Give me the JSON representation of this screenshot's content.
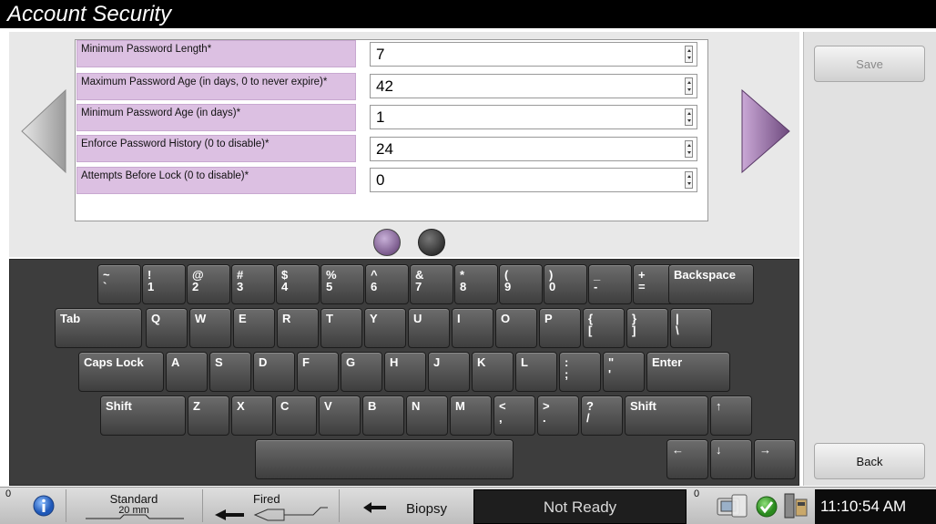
{
  "header": {
    "title": "Account Security"
  },
  "settings": [
    {
      "label": "Minimum Password Length*",
      "value": "7"
    },
    {
      "label": "Maximum Password Age (in days, 0 to never expire)*",
      "value": "42"
    },
    {
      "label": "Minimum Password Age (in days)*",
      "value": "1"
    },
    {
      "label": "Enforce Password History (0 to disable)*",
      "value": "24"
    },
    {
      "label": "Attempts Before Lock (0 to disable)*",
      "value": "0"
    }
  ],
  "pagination": {
    "pages": 2,
    "current": 1
  },
  "side": {
    "save_label": "Save",
    "back_label": "Back"
  },
  "keyboard": {
    "row1": [
      [
        "~",
        "`"
      ],
      [
        "!",
        "1"
      ],
      [
        "@",
        "2"
      ],
      [
        "#",
        "3"
      ],
      [
        "$",
        "4"
      ],
      [
        "%",
        "5"
      ],
      [
        "^",
        "6"
      ],
      [
        "&",
        "7"
      ],
      [
        "*",
        "8"
      ],
      [
        "(",
        "9"
      ],
      [
        ")",
        "0"
      ],
      [
        "_",
        "-"
      ],
      [
        "+",
        "="
      ],
      [
        "Backspace",
        ""
      ]
    ],
    "row2": [
      [
        "Tab",
        ""
      ],
      [
        "Q",
        ""
      ],
      [
        "W",
        ""
      ],
      [
        "E",
        ""
      ],
      [
        "R",
        ""
      ],
      [
        "T",
        ""
      ],
      [
        "Y",
        ""
      ],
      [
        "U",
        ""
      ],
      [
        "I",
        ""
      ],
      [
        "O",
        ""
      ],
      [
        "P",
        ""
      ],
      [
        "{",
        "["
      ],
      [
        "}",
        "]"
      ],
      [
        "|",
        "\\"
      ]
    ],
    "row3": [
      [
        "Caps Lock",
        ""
      ],
      [
        "A",
        ""
      ],
      [
        "S",
        ""
      ],
      [
        "D",
        ""
      ],
      [
        "F",
        ""
      ],
      [
        "G",
        ""
      ],
      [
        "H",
        ""
      ],
      [
        "J",
        ""
      ],
      [
        "K",
        ""
      ],
      [
        "L",
        ""
      ],
      [
        ":",
        ";"
      ],
      [
        "\"",
        "'"
      ],
      [
        "Enter",
        ""
      ]
    ],
    "row4": [
      [
        "Shift",
        ""
      ],
      [
        "Z",
        ""
      ],
      [
        "X",
        ""
      ],
      [
        "C",
        ""
      ],
      [
        "V",
        ""
      ],
      [
        "B",
        ""
      ],
      [
        "N",
        ""
      ],
      [
        "M",
        ""
      ],
      [
        "<",
        ","
      ],
      [
        ">",
        "."
      ],
      [
        "?",
        "/"
      ],
      [
        "Shift",
        ""
      ],
      [
        "↑",
        ""
      ]
    ],
    "row5": [
      [
        "",
        ""
      ],
      [
        "←",
        ""
      ],
      [
        "↓",
        ""
      ],
      [
        "→",
        ""
      ]
    ]
  },
  "status": {
    "left_count": "0",
    "paddle_name": "Standard",
    "paddle_size": "20 mm",
    "fired_label": "Fired",
    "biopsy_label": "Biopsy",
    "ready_state": "Not Ready",
    "right_count": "0",
    "time": "11:10:54 AM"
  }
}
